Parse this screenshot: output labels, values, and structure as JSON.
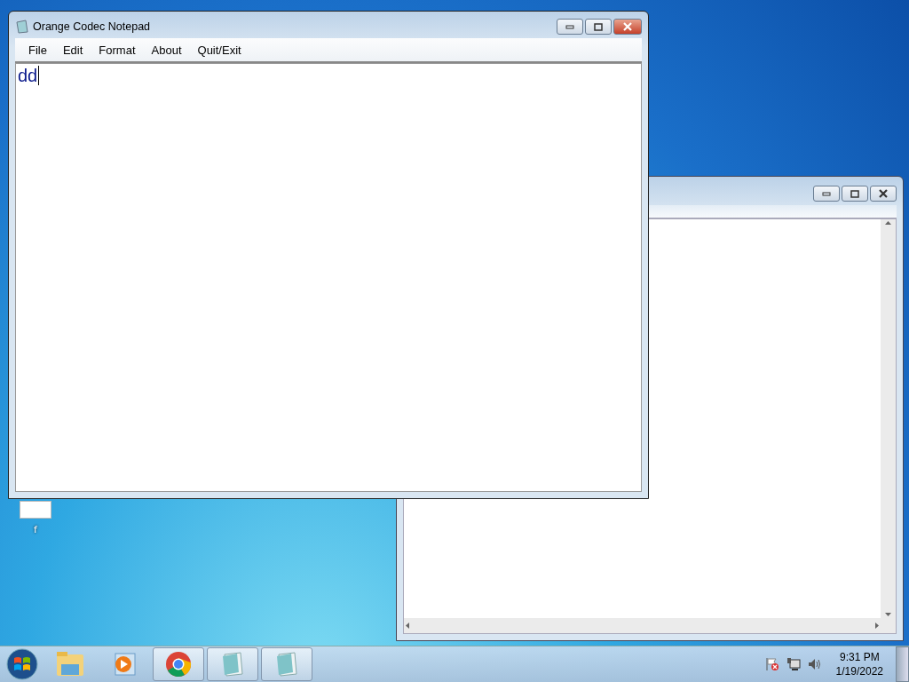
{
  "desktop": {
    "icons": [
      {
        "label": "f"
      }
    ]
  },
  "notepad_window": {
    "title": "Orange Codec Notepad",
    "menu": [
      {
        "label": "File"
      },
      {
        "label": "Edit"
      },
      {
        "label": "Format"
      },
      {
        "label": "About"
      },
      {
        "label": "Quit/Exit"
      }
    ],
    "text": "dd"
  },
  "taskbar": {
    "items": [
      {
        "kind": "folder",
        "running": false
      },
      {
        "kind": "media",
        "running": false
      },
      {
        "kind": "chrome",
        "running": true
      },
      {
        "kind": "notepad",
        "running": true
      },
      {
        "kind": "notepad",
        "running": true
      }
    ],
    "clock": {
      "time": "9:31 PM",
      "date": "1/19/2022"
    }
  }
}
